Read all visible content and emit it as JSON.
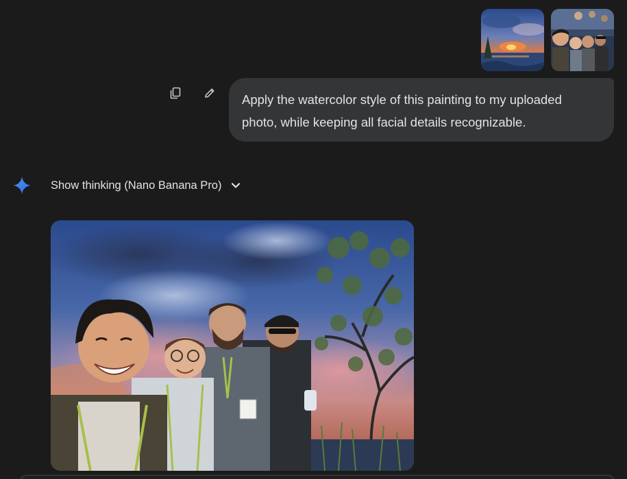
{
  "user_message": {
    "text": "Apply the watercolor style of this painting to my uploaded photo, while keeping all facial details recognizable.",
    "attachments": [
      {
        "kind": "painting",
        "icon": "watercolor-sunset-thumbnail"
      },
      {
        "kind": "photo",
        "icon": "group-selfie-thumbnail"
      }
    ],
    "actions": {
      "copy_icon": "copy-icon",
      "edit_icon": "pencil-icon"
    }
  },
  "response": {
    "thinking_label": "Show thinking (Nano Banana Pro)",
    "spark_icon": "gemini-spark-icon",
    "chevron_icon": "chevron-down-icon",
    "image_icon": "generated-watercolor-group-portrait"
  },
  "colors": {
    "background": "#1b1b1b",
    "bubble": "#333537",
    "text": "#e3e3e3",
    "spark_blue": "#4285f4"
  }
}
